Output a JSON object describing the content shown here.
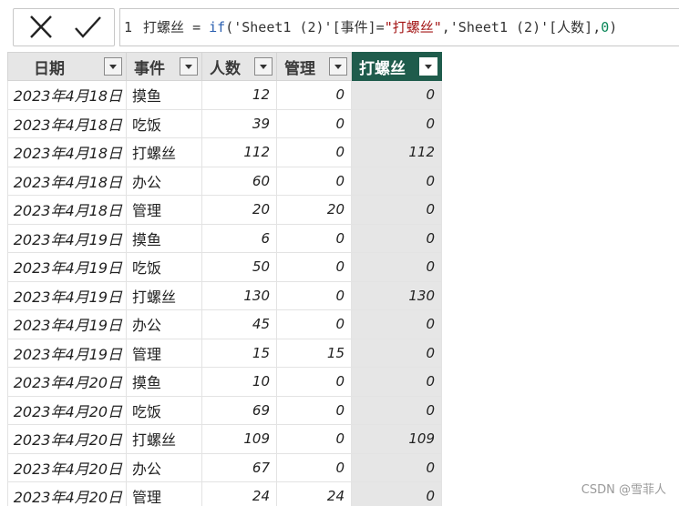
{
  "formula_bar": {
    "line_number": "1",
    "tokens": [
      {
        "cls": "tk-name",
        "text": "打螺丝 "
      },
      {
        "cls": "tk-op",
        "text": "= "
      },
      {
        "cls": "tk-fn",
        "text": "if"
      },
      {
        "cls": "tk-punct",
        "text": "("
      },
      {
        "cls": "tk-ref",
        "text": "'Sheet1 (2)'[事件]"
      },
      {
        "cls": "tk-op",
        "text": "="
      },
      {
        "cls": "tk-str",
        "text": "\"打螺丝\""
      },
      {
        "cls": "tk-punct",
        "text": ","
      },
      {
        "cls": "tk-ref",
        "text": "'Sheet1 (2)'[人数]"
      },
      {
        "cls": "tk-punct",
        "text": ","
      },
      {
        "cls": "tk-num",
        "text": "0"
      },
      {
        "cls": "tk-punct",
        "text": ")"
      }
    ]
  },
  "table": {
    "headers": {
      "date": "日期",
      "event": "事件",
      "people": "人数",
      "manage": "管理",
      "screw": "打螺丝"
    },
    "rows": [
      {
        "date": "2023年4月18日",
        "event": "摸鱼",
        "people": "12",
        "manage": "0",
        "screw": "0"
      },
      {
        "date": "2023年4月18日",
        "event": "吃饭",
        "people": "39",
        "manage": "0",
        "screw": "0"
      },
      {
        "date": "2023年4月18日",
        "event": "打螺丝",
        "people": "112",
        "manage": "0",
        "screw": "112"
      },
      {
        "date": "2023年4月18日",
        "event": "办公",
        "people": "60",
        "manage": "0",
        "screw": "0"
      },
      {
        "date": "2023年4月18日",
        "event": "管理",
        "people": "20",
        "manage": "20",
        "screw": "0"
      },
      {
        "date": "2023年4月19日",
        "event": "摸鱼",
        "people": "6",
        "manage": "0",
        "screw": "0"
      },
      {
        "date": "2023年4月19日",
        "event": "吃饭",
        "people": "50",
        "manage": "0",
        "screw": "0"
      },
      {
        "date": "2023年4月19日",
        "event": "打螺丝",
        "people": "130",
        "manage": "0",
        "screw": "130"
      },
      {
        "date": "2023年4月19日",
        "event": "办公",
        "people": "45",
        "manage": "0",
        "screw": "0"
      },
      {
        "date": "2023年4月19日",
        "event": "管理",
        "people": "15",
        "manage": "15",
        "screw": "0"
      },
      {
        "date": "2023年4月20日",
        "event": "摸鱼",
        "people": "10",
        "manage": "0",
        "screw": "0"
      },
      {
        "date": "2023年4月20日",
        "event": "吃饭",
        "people": "69",
        "manage": "0",
        "screw": "0"
      },
      {
        "date": "2023年4月20日",
        "event": "打螺丝",
        "people": "109",
        "manage": "0",
        "screw": "109"
      },
      {
        "date": "2023年4月20日",
        "event": "办公",
        "people": "67",
        "manage": "0",
        "screw": "0"
      },
      {
        "date": "2023年4月20日",
        "event": "管理",
        "people": "24",
        "manage": "24",
        "screw": "0"
      }
    ]
  },
  "watermark": "CSDN @雪菲人",
  "colors": {
    "active_header": "#1f5c4c",
    "header_bg": "#e6e6e6",
    "active_column_bg": "#e6e6e6",
    "function_blue": "#2a5fb0",
    "string_red": "#a31515",
    "number_green": "#098658"
  },
  "icons": {
    "cancel": "close-icon",
    "commit": "check-icon",
    "filter": "chevron-down-icon"
  }
}
